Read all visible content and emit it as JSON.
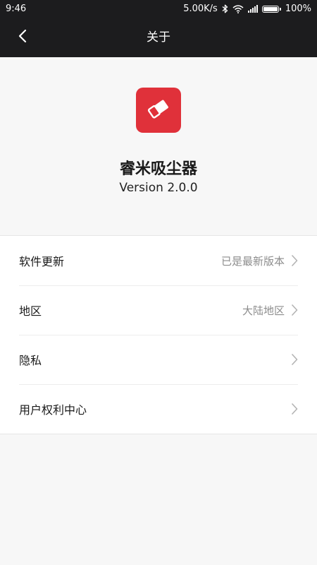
{
  "status_bar": {
    "time": "9:46",
    "network_speed": "5.00K/s",
    "battery_level": "100%",
    "icons": [
      "bluetooth-icon",
      "wifi-icon",
      "signal-icon",
      "battery-icon"
    ]
  },
  "header": {
    "title": "关于",
    "back_icon": "chevron-left-icon"
  },
  "app": {
    "icon": "eraser-icon",
    "icon_color": "#e0313a",
    "name": "睿米吸尘器",
    "version": "Version 2.0.0"
  },
  "settings": {
    "items": [
      {
        "label": "软件更新",
        "value": "已是最新版本"
      },
      {
        "label": "地区",
        "value": "大陆地区"
      },
      {
        "label": "隐私",
        "value": ""
      },
      {
        "label": "用户权利中心",
        "value": ""
      }
    ]
  },
  "colors": {
    "header_bg": "#1c1c1e",
    "page_bg": "#f7f7f7",
    "accent": "#e0313a"
  }
}
